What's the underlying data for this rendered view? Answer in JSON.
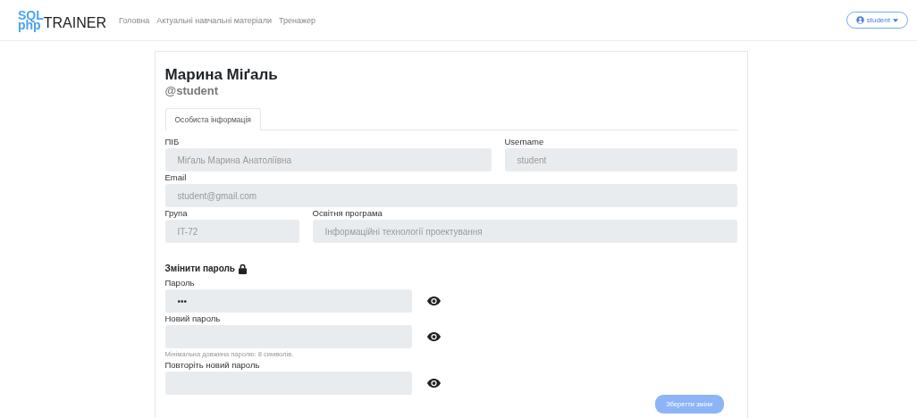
{
  "navbar": {
    "logo": {
      "line1": "SQL",
      "line2": "php",
      "word": "TRAINER"
    },
    "links": [
      {
        "label": "Головна"
      },
      {
        "label": "Актуальні навчальні матеріали"
      },
      {
        "label": "Тренажер"
      }
    ],
    "user_menu": {
      "label": "student"
    }
  },
  "profile": {
    "name": "Марина Міґаль",
    "handle": "@student",
    "tabs": [
      {
        "label": "Особиста інформація",
        "selected": true
      }
    ],
    "field_rows": [
      [
        {
          "label": "ПІБ",
          "value": "Міґаль Марина Анатоліївна",
          "disabled": true
        },
        {
          "label": "Username",
          "value": "student",
          "disabled": true
        }
      ],
      [
        {
          "label": "Email",
          "value": "student@gmail.com",
          "disabled": true
        }
      ],
      [
        {
          "label": "Група",
          "value": "IT-72",
          "disabled": true
        },
        {
          "label": "Освітня програма",
          "value": "Інформаційні технології проектування",
          "disabled": true
        }
      ]
    ],
    "password_section": {
      "title": "Змінити пароль",
      "fields": [
        {
          "label": "Пароль",
          "value": "•••"
        },
        {
          "label": "Новий пароль",
          "hint": "Мінімальна довжина паролю: 8 символів."
        },
        {
          "label": "Повторіть новий пароль"
        }
      ]
    },
    "save_button": {
      "label": "Зберегти зміни",
      "disabled": true
    }
  }
}
